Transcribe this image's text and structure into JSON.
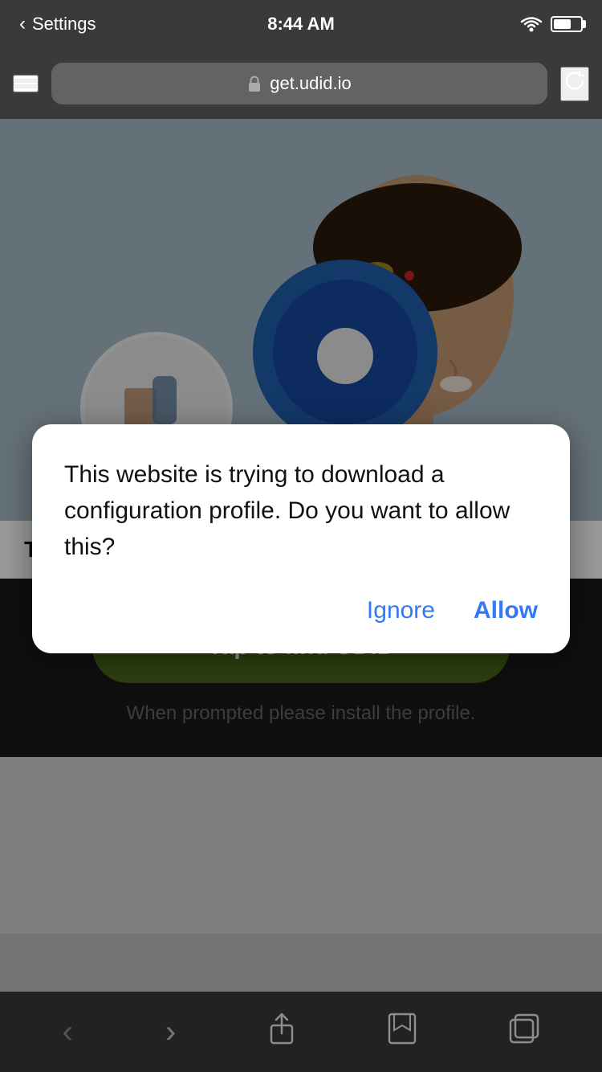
{
  "statusBar": {
    "backLabel": "Settings",
    "time": "8:44 AM"
  },
  "browserBar": {
    "url": "get.udid.io"
  },
  "article": {
    "title": "The cost of hearing aids in Pune"
  },
  "tapButton": {
    "label": "Tap to find UDID"
  },
  "promptText": "When prompted please install the profile.",
  "dialog": {
    "message": "This website is trying to download a configuration profile. Do you want to allow this?",
    "ignoreLabel": "Ignore",
    "allowLabel": "Allow"
  },
  "bottomNav": {
    "back": "‹",
    "forward": "›",
    "share": "share",
    "bookmarks": "bookmarks",
    "tabs": "tabs"
  }
}
